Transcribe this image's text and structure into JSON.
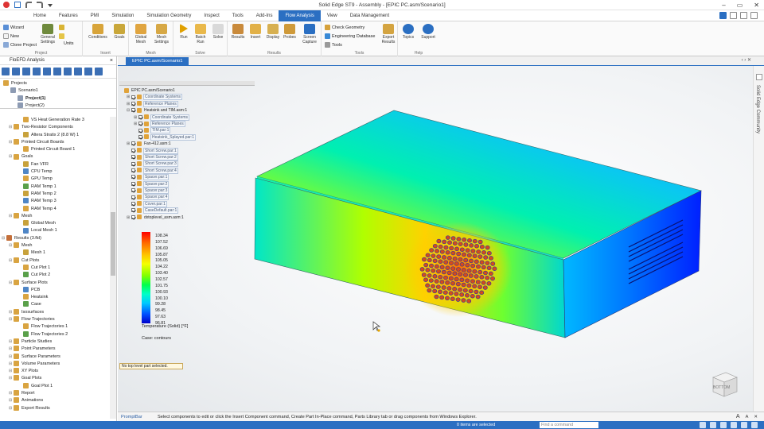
{
  "app": {
    "title": "Solid Edge ST9 - Assembly - [EPIC PC.asm/Scenario1]"
  },
  "menu": {
    "tabs": [
      "Home",
      "Features",
      "PMI",
      "Simulation",
      "Simulation Geometry",
      "Inspect",
      "Tools",
      "Add-Ins",
      "Flow Analysis",
      "View",
      "Data Management"
    ],
    "active": "Flow Analysis"
  },
  "ribbon": {
    "project": {
      "wizard": "Wizard",
      "new": "New",
      "clone": "Clone Project",
      "general": "General Settings",
      "units": "Units",
      "label": "Project"
    },
    "insert": {
      "conditions": "Conditions",
      "goals": "Goals",
      "label": "Insert"
    },
    "mesh": {
      "global": "Global Mesh",
      "settings": "Mesh Settings",
      "label": "Mesh"
    },
    "solve": {
      "run": "Run",
      "batch": "Batch Run",
      "solve": "Solve",
      "label": "Solve"
    },
    "results": {
      "results": "Results",
      "insert": "Insert",
      "display": "Display",
      "probes": "Probes",
      "capture": "Screen Capture",
      "label": "Results"
    },
    "tools": {
      "check": "Check Geometry",
      "engineering": "Engineering Database",
      "tools": "Tools",
      "export": "Export Results",
      "label": "Tools"
    },
    "help": {
      "topics": "Topics",
      "support": "Support",
      "label": "Help"
    }
  },
  "left_panel": {
    "title": "FloEFD Analysis",
    "projects": [
      {
        "label": "Projects",
        "indent": 0
      },
      {
        "label": "Scenario1",
        "indent": 1
      },
      {
        "label": "Project(1)",
        "indent": 2,
        "bold": true
      },
      {
        "label": "Project(2)",
        "indent": 2
      }
    ],
    "tree": [
      {
        "label": "VS Heat Generation Rate 3",
        "indent": 3
      },
      {
        "label": "Two-Resistor Components",
        "indent": 1
      },
      {
        "label": "Altera Stratix 2 (8.8 W) 1",
        "indent": 3
      },
      {
        "label": "Printed Circuit Boards",
        "indent": 1
      },
      {
        "label": "Printed Circuit Board 1",
        "indent": 3
      },
      {
        "label": "Goals",
        "indent": 1
      },
      {
        "label": "Fan VFR",
        "indent": 3
      },
      {
        "label": "CPU Temp",
        "indent": 3
      },
      {
        "label": "GPU Temp",
        "indent": 3
      },
      {
        "label": "RAM Temp 1",
        "indent": 3
      },
      {
        "label": "RAM Temp 2",
        "indent": 3
      },
      {
        "label": "RAM Temp 3",
        "indent": 3
      },
      {
        "label": "RAM Temp 4",
        "indent": 3
      },
      {
        "label": "Mesh",
        "indent": 1
      },
      {
        "label": "Global Mesh",
        "indent": 3
      },
      {
        "label": "Local Mesh 1",
        "indent": 3
      },
      {
        "label": "Results (3.fld)",
        "indent": 0
      },
      {
        "label": "Mesh",
        "indent": 1
      },
      {
        "label": "Mesh 1",
        "indent": 3
      },
      {
        "label": "Cut Plots",
        "indent": 1
      },
      {
        "label": "Cut Plot 1",
        "indent": 3
      },
      {
        "label": "Cut Plot 2",
        "indent": 3
      },
      {
        "label": "Surface Plots",
        "indent": 1
      },
      {
        "label": "PCB",
        "indent": 3
      },
      {
        "label": "Heatsink",
        "indent": 3
      },
      {
        "label": "Case",
        "indent": 3
      },
      {
        "label": "Isosurfaces",
        "indent": 1
      },
      {
        "label": "Flow Trajectories",
        "indent": 1
      },
      {
        "label": "Flow Trajectories 1",
        "indent": 3
      },
      {
        "label": "Flow Trajectories 2",
        "indent": 3
      },
      {
        "label": "Particle Studies",
        "indent": 1
      },
      {
        "label": "Point Parameters",
        "indent": 1
      },
      {
        "label": "Surface Parameters",
        "indent": 1
      },
      {
        "label": "Volume Parameters",
        "indent": 1
      },
      {
        "label": "XY Plots",
        "indent": 1
      },
      {
        "label": "Goal Plots",
        "indent": 1
      },
      {
        "label": "Goal Plot 1",
        "indent": 3
      },
      {
        "label": "Report",
        "indent": 1
      },
      {
        "label": "Animations",
        "indent": 1
      },
      {
        "label": "Export Results",
        "indent": 1
      }
    ]
  },
  "document_tab": "EPIC PC.asm/Scenario1",
  "pathfinder": [
    {
      "label": "EPIC PC.asm/Scenario1",
      "indent": 0,
      "ex": "",
      "cb": false,
      "box": false
    },
    {
      "label": "Coordinate Systems",
      "indent": 1,
      "ex": "+",
      "cb": true,
      "box": true
    },
    {
      "label": "Reference Planes",
      "indent": 1,
      "ex": "+",
      "cb": true,
      "box": true
    },
    {
      "label": "Heatsink and TIM.asm:1",
      "indent": 1,
      "ex": "-",
      "cb": true,
      "box": false
    },
    {
      "label": "Coordinate Systems",
      "indent": 2,
      "ex": "+",
      "cb": true,
      "box": true
    },
    {
      "label": "Reference Planes",
      "indent": 2,
      "ex": "+",
      "cb": true,
      "box": true
    },
    {
      "label": "TIM.par:1",
      "indent": 2,
      "ex": "",
      "cb": true,
      "box": true
    },
    {
      "label": "Heatsink_Splayed.par:1",
      "indent": 2,
      "ex": "",
      "cb": true,
      "box": true
    },
    {
      "label": "Fan-412.asm:1",
      "indent": 1,
      "ex": "+",
      "cb": true,
      "box": false
    },
    {
      "label": "Short Screw.par:1",
      "indent": 1,
      "ex": "",
      "cb": true,
      "box": true
    },
    {
      "label": "Short Screw.par:2",
      "indent": 1,
      "ex": "",
      "cb": true,
      "box": true
    },
    {
      "label": "Short Screw.par:3",
      "indent": 1,
      "ex": "",
      "cb": true,
      "box": true
    },
    {
      "label": "Short Screw.par:4",
      "indent": 1,
      "ex": "",
      "cb": true,
      "box": true
    },
    {
      "label": "Spacer.par:1",
      "indent": 1,
      "ex": "",
      "cb": true,
      "box": true
    },
    {
      "label": "Spacer.par:2",
      "indent": 1,
      "ex": "",
      "cb": true,
      "box": true
    },
    {
      "label": "Spacer.par:3",
      "indent": 1,
      "ex": "",
      "cb": true,
      "box": true
    },
    {
      "label": "Spacer.par:4",
      "indent": 1,
      "ex": "",
      "cb": true,
      "box": true
    },
    {
      "label": "Cover.par:1",
      "indent": 1,
      "ex": "",
      "cb": true,
      "box": true
    },
    {
      "label": "CaseDefault.par:1",
      "indent": 1,
      "ex": "",
      "cb": true,
      "box": true
    },
    {
      "label": "dxtoplevel_asm.asm:1",
      "indent": 1,
      "ex": "+",
      "cb": true,
      "box": false
    }
  ],
  "legend": {
    "values": [
      "108.34",
      "107.52",
      "106.69",
      "105.87",
      "105.05",
      "104.22",
      "103.40",
      "102.57",
      "101.75",
      "100.93",
      "100.10",
      "99.28",
      "98.45",
      "97.63",
      "96.81"
    ],
    "title": "Temperature (Solid) [°F]",
    "case": "Case: contours"
  },
  "viewport_note": "No top level part selected.",
  "view_cube_label": "BOTTOM",
  "right_strip_label": "Solid Edge Community",
  "promptbar": {
    "label": "PromptBar",
    "message": "Select components to edit or click the Insert Component command, Create Part In-Place command, Parts Library tab or drag components from Windows Explorer.",
    "controls": [
      "A",
      "A",
      "✕"
    ]
  },
  "status": {
    "count": "0 items are selected",
    "find_placeholder": "Find a command"
  },
  "colors": {
    "accent": "#2b6fc2",
    "legend_top": "#ff0000",
    "legend_bottom": "#0000cc"
  }
}
